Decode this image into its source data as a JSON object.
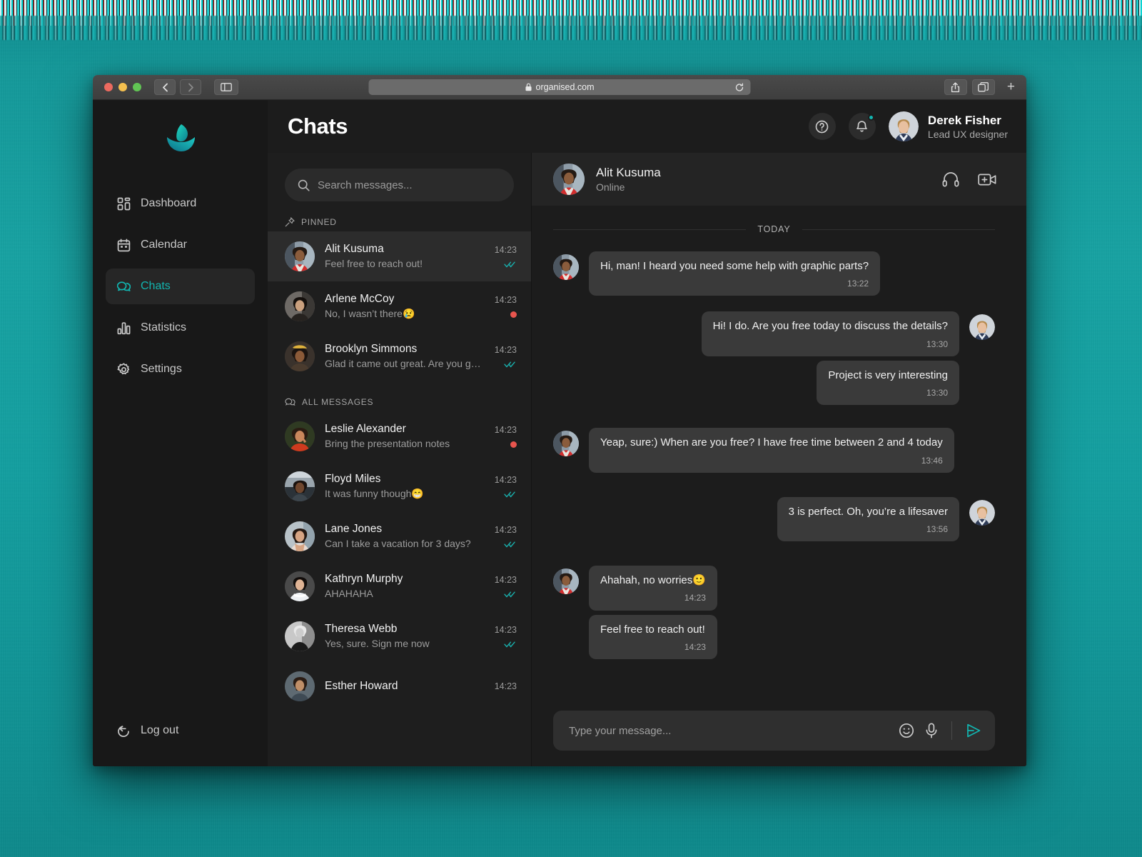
{
  "browser": {
    "url": "organised.com",
    "lock_icon": "lock-icon",
    "reload_icon": "reload-icon",
    "back_icon": "chevron-left-icon",
    "forward_icon": "chevron-right-icon",
    "sidebar_icon": "sidebar-toggle-icon",
    "share_icon": "share-icon",
    "tabs_icon": "tab-overview-icon",
    "new_tab_icon": "plus-icon"
  },
  "sidebar": {
    "logo_name": "leaf-logo",
    "items": [
      {
        "label": "Dashboard",
        "icon": "dashboard-icon",
        "active": false
      },
      {
        "label": "Calendar",
        "icon": "calendar-icon",
        "active": false
      },
      {
        "label": "Chats",
        "icon": "chats-icon",
        "active": true
      },
      {
        "label": "Statistics",
        "icon": "statistics-icon",
        "active": false
      },
      {
        "label": "Settings",
        "icon": "gear-icon",
        "active": false
      }
    ],
    "logout_label": "Log out",
    "logout_icon": "logout-icon"
  },
  "header": {
    "title": "Chats",
    "help_icon": "help-icon",
    "bell_icon": "bell-icon",
    "bell_has_badge": true,
    "user_name": "Derek Fisher",
    "user_role": "Lead UX designer"
  },
  "search": {
    "placeholder": "Search messages...",
    "icon": "search-icon"
  },
  "sections": [
    {
      "label": "PINNED",
      "icon": "pin-icon"
    },
    {
      "label": "ALL MESSAGES",
      "icon": "chats-icon"
    }
  ],
  "pinned_chats": [
    {
      "name": "Alit Kusuma",
      "preview": "Feel free to reach out!",
      "time": "14:23",
      "status": "read",
      "selected": true,
      "avatar": "alit"
    },
    {
      "name": "Arlene McCoy",
      "preview": "No, I wasn’t there😢",
      "time": "14:23",
      "status": "unread",
      "selected": false,
      "avatar": "arlene"
    },
    {
      "name": "Brooklyn Simmons",
      "preview": "Glad it came out great. Are you gonna d...",
      "time": "14:23",
      "status": "read",
      "selected": false,
      "avatar": "brooklyn"
    }
  ],
  "all_chats": [
    {
      "name": "Leslie Alexander",
      "preview": "Bring the presentation notes",
      "time": "14:23",
      "status": "unread",
      "avatar": "leslie"
    },
    {
      "name": "Floyd Miles",
      "preview": "It was funny though😁",
      "time": "14:23",
      "status": "read",
      "avatar": "floyd"
    },
    {
      "name": "Lane Jones",
      "preview": "Can I take a vacation for 3 days?",
      "time": "14:23",
      "status": "read",
      "avatar": "lane"
    },
    {
      "name": "Kathryn Murphy",
      "preview": "AHAHAHA",
      "time": "14:23",
      "status": "read",
      "avatar": "kathryn"
    },
    {
      "name": "Theresa Webb",
      "preview": "Yes, sure. Sign me now",
      "time": "14:23",
      "status": "read",
      "avatar": "theresa"
    },
    {
      "name": "Esther Howard",
      "preview": "",
      "time": "14:23",
      "status": "none",
      "avatar": "esther"
    }
  ],
  "conversation": {
    "name": "Alit Kusuma",
    "status": "Online",
    "headphones_icon": "headphones-icon",
    "video_call_icon": "add-video-call-icon",
    "day_divider": "TODAY",
    "messages": [
      {
        "side": "in",
        "text": "Hi, man! I heard you need some help with graphic parts?",
        "time": "13:22"
      },
      {
        "side": "out",
        "text": "Hi! I do. Are you free today to discuss the details?",
        "time": "13:30"
      },
      {
        "side": "out",
        "text": "Project is very interesting",
        "time": "13:30"
      },
      {
        "side": "in",
        "text": "Yeap, sure:) When are you free? I have free time between 2 and 4 today",
        "time": "13:46"
      },
      {
        "side": "out",
        "text": "3 is perfect. Oh, you’re a lifesaver",
        "time": "13:56"
      },
      {
        "side": "in",
        "text": "Ahahah, no worries🙂",
        "time": "14:23"
      },
      {
        "side": "in",
        "text": "Feel free to reach out!",
        "time": "14:23"
      }
    ]
  },
  "composer": {
    "placeholder": "Type your message...",
    "emoji_icon": "emoji-icon",
    "mic_icon": "microphone-icon",
    "send_icon": "send-icon"
  },
  "colors": {
    "accent": "#12b5b0",
    "unread": "#e8554e",
    "background": "#16a3a3",
    "app_bg": "#1c1c1c"
  }
}
